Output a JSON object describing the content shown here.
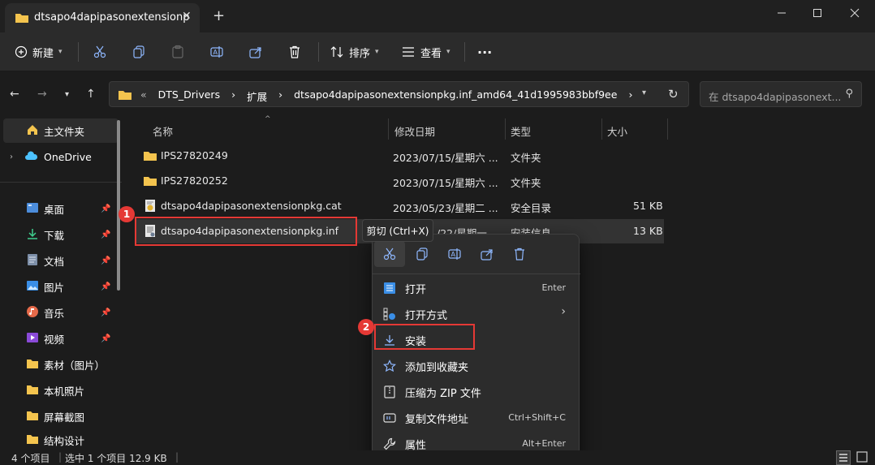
{
  "window": {
    "tab_title": "dtsapo4dapipasonextensionp",
    "new_tab": "+"
  },
  "toolbar": {
    "new_label": "新建",
    "sort_label": "排序",
    "view_label": "查看",
    "more_label": "···"
  },
  "address": {
    "overflow": "«",
    "crumbs": [
      "DTS_Drivers",
      "扩展",
      "dtsapo4dapipasonextensionpkg.inf_amd64_41d1995983bbf9ee"
    ],
    "separator": "›"
  },
  "search": {
    "placeholder": "在 dtsapo4dapipasonext..."
  },
  "sidebar": {
    "items": [
      {
        "label": "主文件夹",
        "icon": "home-icon"
      },
      {
        "label": "OneDrive",
        "icon": "cloud-icon"
      },
      {
        "label": "桌面",
        "icon": "desktop-icon"
      },
      {
        "label": "下载",
        "icon": "download-icon"
      },
      {
        "label": "文档",
        "icon": "document-icon"
      },
      {
        "label": "图片",
        "icon": "picture-icon"
      },
      {
        "label": "音乐",
        "icon": "music-icon"
      },
      {
        "label": "视频",
        "icon": "video-icon"
      },
      {
        "label": "素材（图片）",
        "icon": "folder-icon"
      },
      {
        "label": "本机照片",
        "icon": "folder-icon"
      },
      {
        "label": "屏幕截图",
        "icon": "folder-icon"
      },
      {
        "label": "结构设计",
        "icon": "folder-icon"
      }
    ]
  },
  "columns": {
    "name": "名称",
    "date": "修改日期",
    "type": "类型",
    "size": "大小"
  },
  "files": [
    {
      "name": "IPS27820249",
      "date": "2023/07/15/星期六 ...",
      "type": "文件夹",
      "size": ""
    },
    {
      "name": "IPS27820252",
      "date": "2023/07/15/星期六 ...",
      "type": "文件夹",
      "size": ""
    },
    {
      "name": "dtsapo4dapipasonextensionpkg.cat",
      "date": "2023/05/23/星期二 ...",
      "type": "安全目录",
      "size": "51 KB"
    },
    {
      "name": "dtsapo4dapipasonextensionpkg.inf",
      "date": "/22/星期一",
      "type": "安装信息",
      "size": "13 KB"
    }
  ],
  "tooltip": "剪切 (Ctrl+X)",
  "context_menu": {
    "items": [
      {
        "label": "打开",
        "shortcut": "Enter"
      },
      {
        "label": "打开方式",
        "shortcut": "›"
      },
      {
        "label": "安装",
        "shortcut": ""
      },
      {
        "label": "添加到收藏夹",
        "shortcut": ""
      },
      {
        "label": "压缩为 ZIP 文件",
        "shortcut": ""
      },
      {
        "label": "复制文件地址",
        "shortcut": "Ctrl+Shift+C"
      },
      {
        "label": "属性",
        "shortcut": "Alt+Enter"
      }
    ]
  },
  "badges": [
    "1",
    "2"
  ],
  "statusbar": {
    "count": "4 个项目",
    "selected": "选中 1 个项目  12.9 KB"
  },
  "colors": {
    "accent": "#4cc2ff",
    "folder": "#f4c44e",
    "highlight_red": "#e53935"
  }
}
